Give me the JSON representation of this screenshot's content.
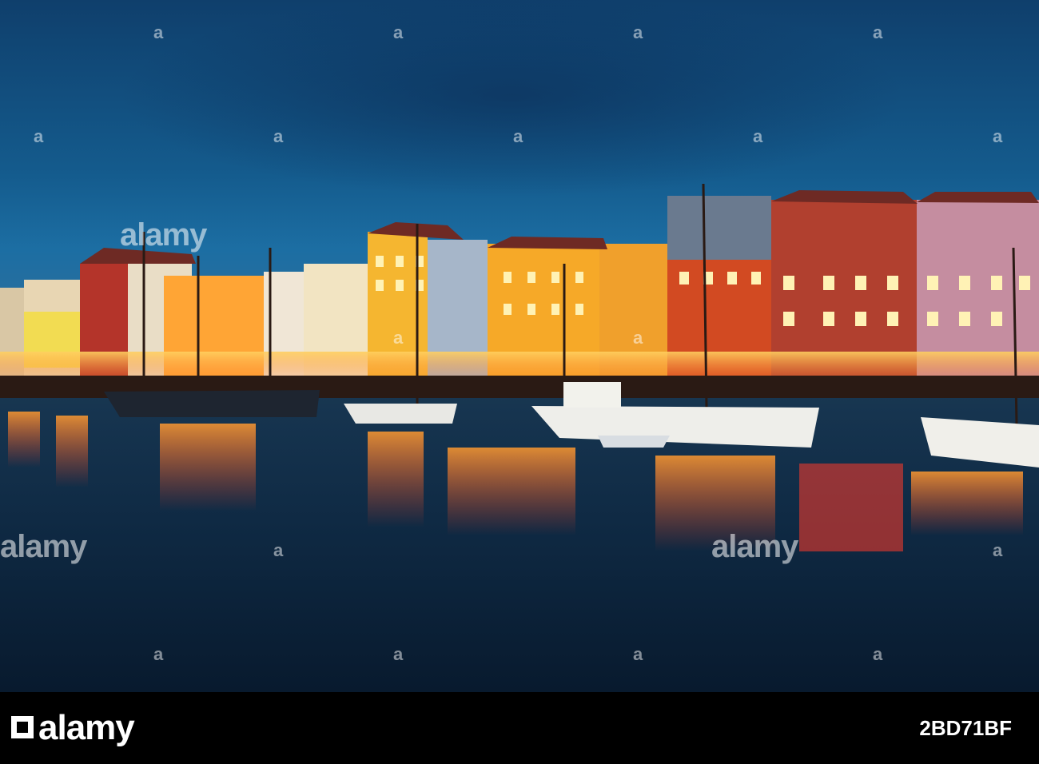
{
  "photo": {
    "subject": "harbour canal at dusk",
    "sky_color": "#145b8d",
    "water_color": "#0f2a44",
    "light_color": "#ffb340"
  },
  "watermark": {
    "text": "alamy",
    "mark": "a"
  },
  "footer": {
    "logo": "alamy",
    "image_id": "2BD71BF"
  }
}
